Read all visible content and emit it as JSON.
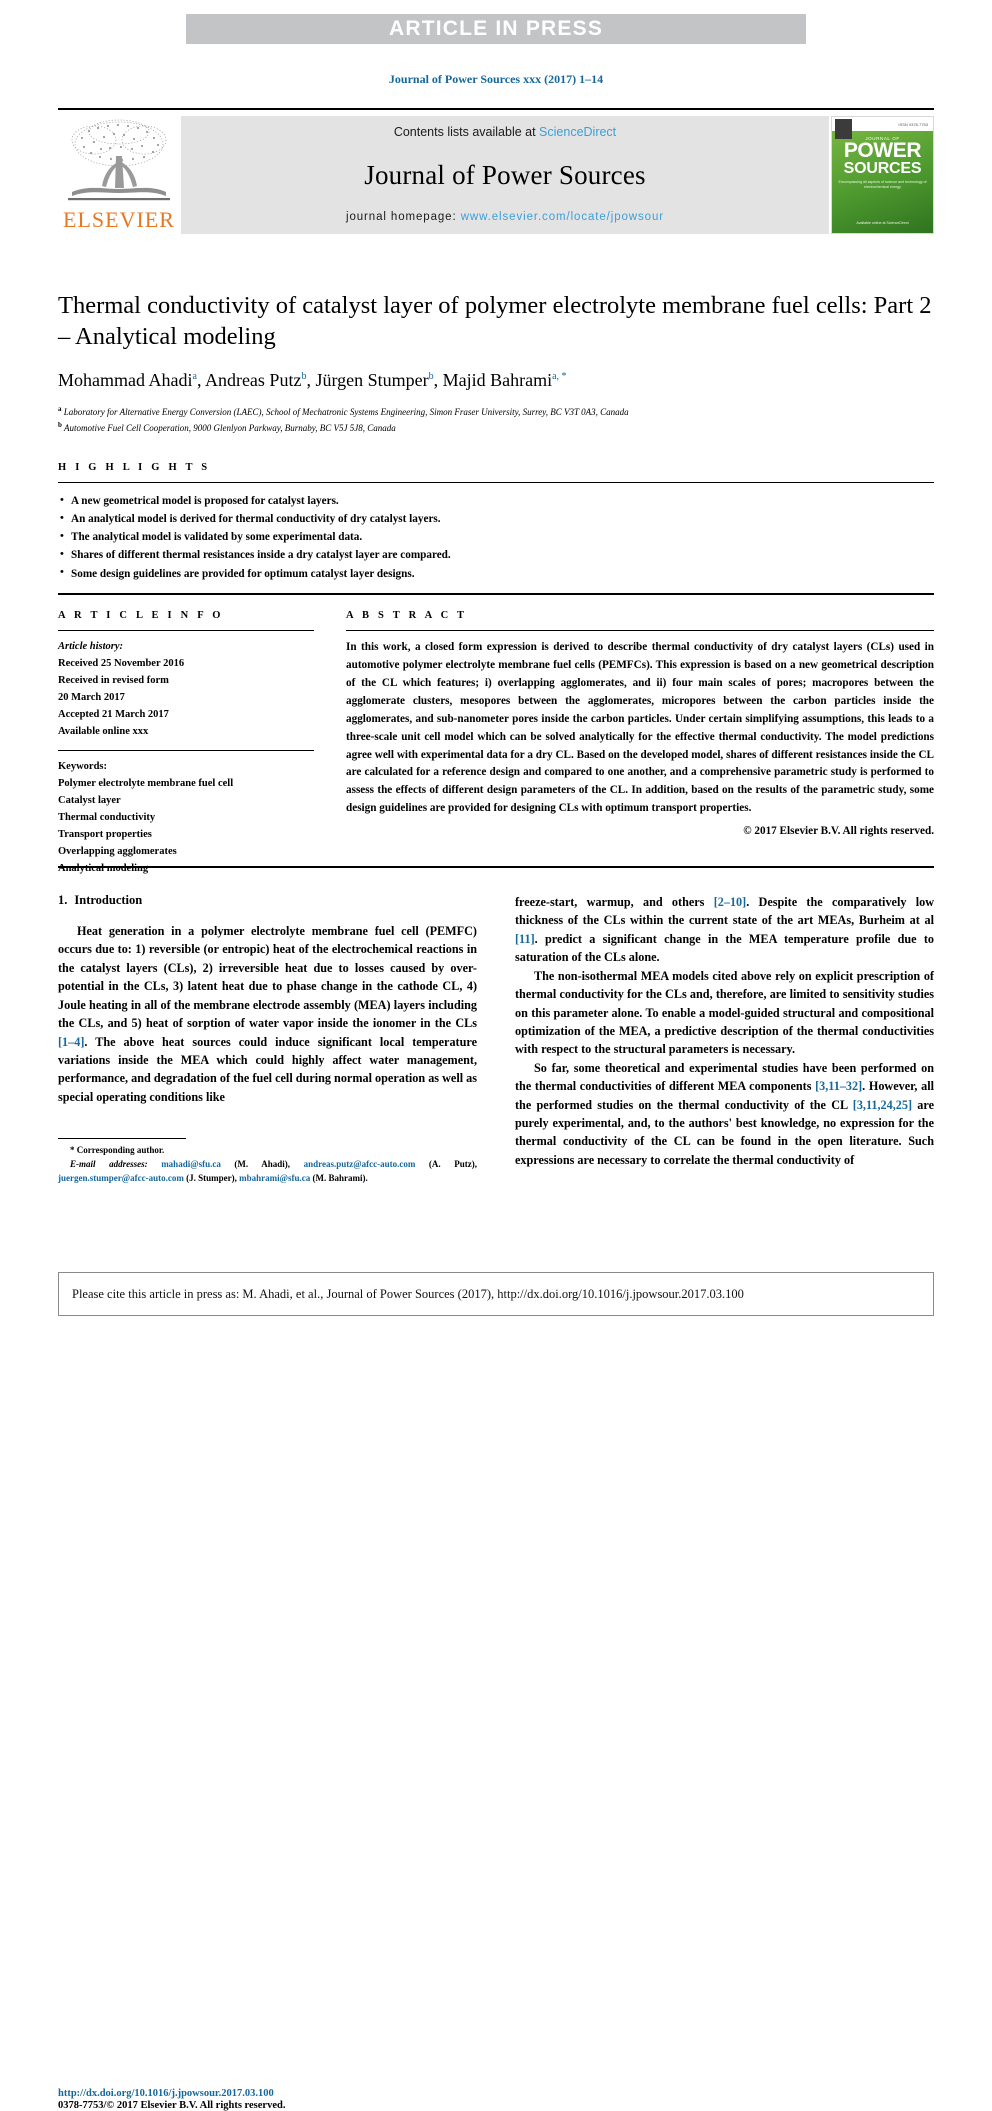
{
  "banner": {
    "text": "ARTICLE IN PRESS"
  },
  "running_head": "Journal of Power Sources xxx (2017) 1–14",
  "masthead": {
    "contents_prefix": "Contents lists available at ",
    "sciencedirect": "ScienceDirect",
    "journal_name": "Journal of Power Sources",
    "homepage_label": "journal homepage: ",
    "homepage_url": "www.elsevier.com/locate/jpowsour",
    "publisher_logo_text": "ELSEVIER",
    "publisher_logo_icon": "elsevier-tree-icon",
    "cover": {
      "kicker": "JOURNAL OF",
      "title_line1": "POWER",
      "title_line2": "SOURCES",
      "subtitle": "Encompassing all aspects of\nscience and technology of electrochemical energy",
      "footer": "Available online at\nScienceDirect",
      "issn": "ISSN 0378-7753"
    }
  },
  "article": {
    "title": "Thermal conductivity of catalyst layer of polymer electrolyte membrane fuel cells: Part 2 – Analytical modeling",
    "authors": [
      {
        "name": "Mohammad Ahadi",
        "marks": "a"
      },
      {
        "name": "Andreas Putz",
        "marks": "b"
      },
      {
        "name": "Jürgen Stumper",
        "marks": "b"
      },
      {
        "name": "Majid Bahrami",
        "marks": "a, *"
      }
    ],
    "affiliations": [
      {
        "mark": "a",
        "text": "Laboratory for Alternative Energy Conversion (LAEC), School of Mechatronic Systems Engineering, Simon Fraser University, Surrey, BC V3T 0A3, Canada"
      },
      {
        "mark": "b",
        "text": "Automotive Fuel Cell Cooperation, 9000 Glenlyon Parkway, Burnaby, BC V5J 5J8, Canada"
      }
    ]
  },
  "highlights": {
    "heading": "H I G H L I G H T S",
    "items": [
      "A new geometrical model is proposed for catalyst layers.",
      "An analytical model is derived for thermal conductivity of dry catalyst layers.",
      "The analytical model is validated by some experimental data.",
      "Shares of different thermal resistances inside a dry catalyst layer are compared.",
      "Some design guidelines are provided for optimum catalyst layer designs."
    ]
  },
  "article_info": {
    "heading": "A R T I C L E  I N F O",
    "history_label": "Article history:",
    "history": [
      "Received 25 November 2016",
      "Received in revised form",
      "20 March 2017",
      "Accepted 21 March 2017",
      "Available online xxx"
    ],
    "keywords_label": "Keywords:",
    "keywords": [
      "Polymer electrolyte membrane fuel cell",
      "Catalyst layer",
      "Thermal conductivity",
      "Transport properties",
      "Overlapping agglomerates",
      "Analytical modeling"
    ]
  },
  "abstract": {
    "heading": "A B S T R A C T",
    "text": "In this work, a closed form expression is derived to describe thermal conductivity of dry catalyst layers (CLs) used in automotive polymer electrolyte membrane fuel cells (PEMFCs). This expression is based on a new geometrical description of the CL which features; i) overlapping agglomerates, and ii) four main scales of pores; macropores between the agglomerate clusters, mesopores between the agglomerates, micropores between the carbon particles inside the agglomerates, and sub-nanometer pores inside the carbon particles. Under certain simplifying assumptions, this leads to a three-scale unit cell model which can be solved analytically for the effective thermal conductivity. The model predictions agree well with experimental data for a dry CL. Based on the developed model, shares of different resistances inside the CL are calculated for a reference design and compared to one another, and a comprehensive parametric study is performed to assess the effects of different design parameters of the CL. In addition, based on the results of the parametric study, some design guidelines are provided for designing CLs with optimum transport properties.",
    "copyright": "© 2017 Elsevier B.V. All rights reserved."
  },
  "body": {
    "section_number": "1.",
    "section_title": "Introduction",
    "left_paragraphs": [
      "Heat generation in a polymer electrolyte membrane fuel cell (PEMFC) occurs due to: 1) reversible (or entropic) heat of the electrochemical reactions in the catalyst layers (CLs), 2) irreversible heat due to losses caused by over-potential in the CLs, 3) latent heat due to phase change in the cathode CL, 4) Joule heating in all of the membrane electrode assembly (MEA) layers including the CLs, and 5) heat of sorption of water vapor inside the ionomer in the CLs [1–4]. The above heat sources could induce significant local temperature variations inside the MEA which could highly affect water management, performance, and degradation of the fuel cell during normal operation as well as special operating conditions like"
    ],
    "right_paragraphs": [
      "freeze-start, warmup, and others [2–10]. Despite the comparatively low thickness of the CLs within the current state of the art MEAs, Burheim at al [11]. predict a significant change in the MEA temperature profile due to saturation of the CLs alone.",
      "The non-isothermal MEA models cited above rely on explicit prescription of thermal conductivity for the CLs and, therefore, are limited to sensitivity studies on this parameter alone. To enable a model-guided structural and compositional optimization of the MEA, a predictive description of the thermal conductivities with respect to the structural parameters is necessary.",
      "So far, some theoretical and experimental studies have been performed on the thermal conductivities of different MEA components [3,11–32]. However, all the performed studies on the thermal conductivity of the CL [3,11,24,25] are purely experimental, and, to the authors' best knowledge, no expression for the thermal conductivity of the CL can be found in the open literature. Such expressions are necessary to correlate the thermal conductivity of"
    ]
  },
  "footnote": {
    "corresponding": "Corresponding author.",
    "email_label": "E-mail addresses:",
    "emails": [
      {
        "address": "mahadi@sfu.ca",
        "person": "(M. Ahadi)"
      },
      {
        "address": "andreas.putz@afcc-auto.com",
        "person": "(A. Putz)"
      },
      {
        "address": "juergen.stumper@afcc-auto.com",
        "person": "(J. Stumper)"
      },
      {
        "address": "mbahrami@sfu.ca",
        "person": "(M. Bahrami)"
      }
    ],
    "doi": "http://dx.doi.org/10.1016/j.jpowsour.2017.03.100",
    "issn_line": "0378-7753/© 2017 Elsevier B.V. All rights reserved."
  },
  "cite_footer": {
    "text": "Please cite this article in press as: M. Ahadi, et al., Journal of Power Sources (2017), http://dx.doi.org/10.1016/j.jpowsour.2017.03.100"
  },
  "colors": {
    "link_blue": "#15689c",
    "sciencedirect_blue": "#3c9fd6",
    "elsevier_orange": "#e87722",
    "banner_grey": "#c3c4c6",
    "masthead_grey": "#e3e3e3"
  }
}
